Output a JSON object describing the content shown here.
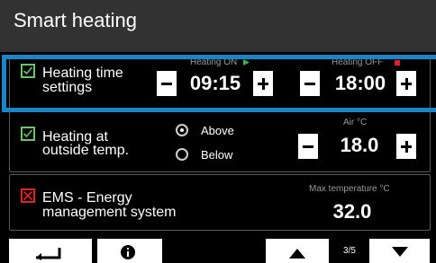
{
  "title": "Smart heating",
  "rows": [
    {
      "label_line1": "Heating time",
      "label_line2": "settings",
      "checked": true,
      "on_label": "Heating ON",
      "off_label": "Heating OFF",
      "on_time": "09:15",
      "off_time": "18:00",
      "on_indicator_color": "#35b34a",
      "off_indicator_color": "#e02424"
    },
    {
      "label_line1": "Heating at",
      "label_line2": "outside temp.",
      "checked": true,
      "radio_options": [
        "Above",
        "Below"
      ],
      "selected_option": "Above",
      "value_label": "Air °C",
      "value": "18.0"
    },
    {
      "label_line1": "EMS - Energy",
      "label_line2": "management system",
      "checked": false,
      "value_label": "Max temperature °C",
      "value": "32.0"
    }
  ],
  "footer": {
    "back_icon": "return-arrow-icon",
    "info_icon": "info-icon",
    "up_icon": "triangle-up-icon",
    "down_icon": "triangle-down-icon",
    "page_indicator": "3/5"
  },
  "colors": {
    "title_bar": "#323232",
    "selection": "#1b86c7",
    "check_green": "#6cc46a",
    "check_red": "#e02424"
  }
}
